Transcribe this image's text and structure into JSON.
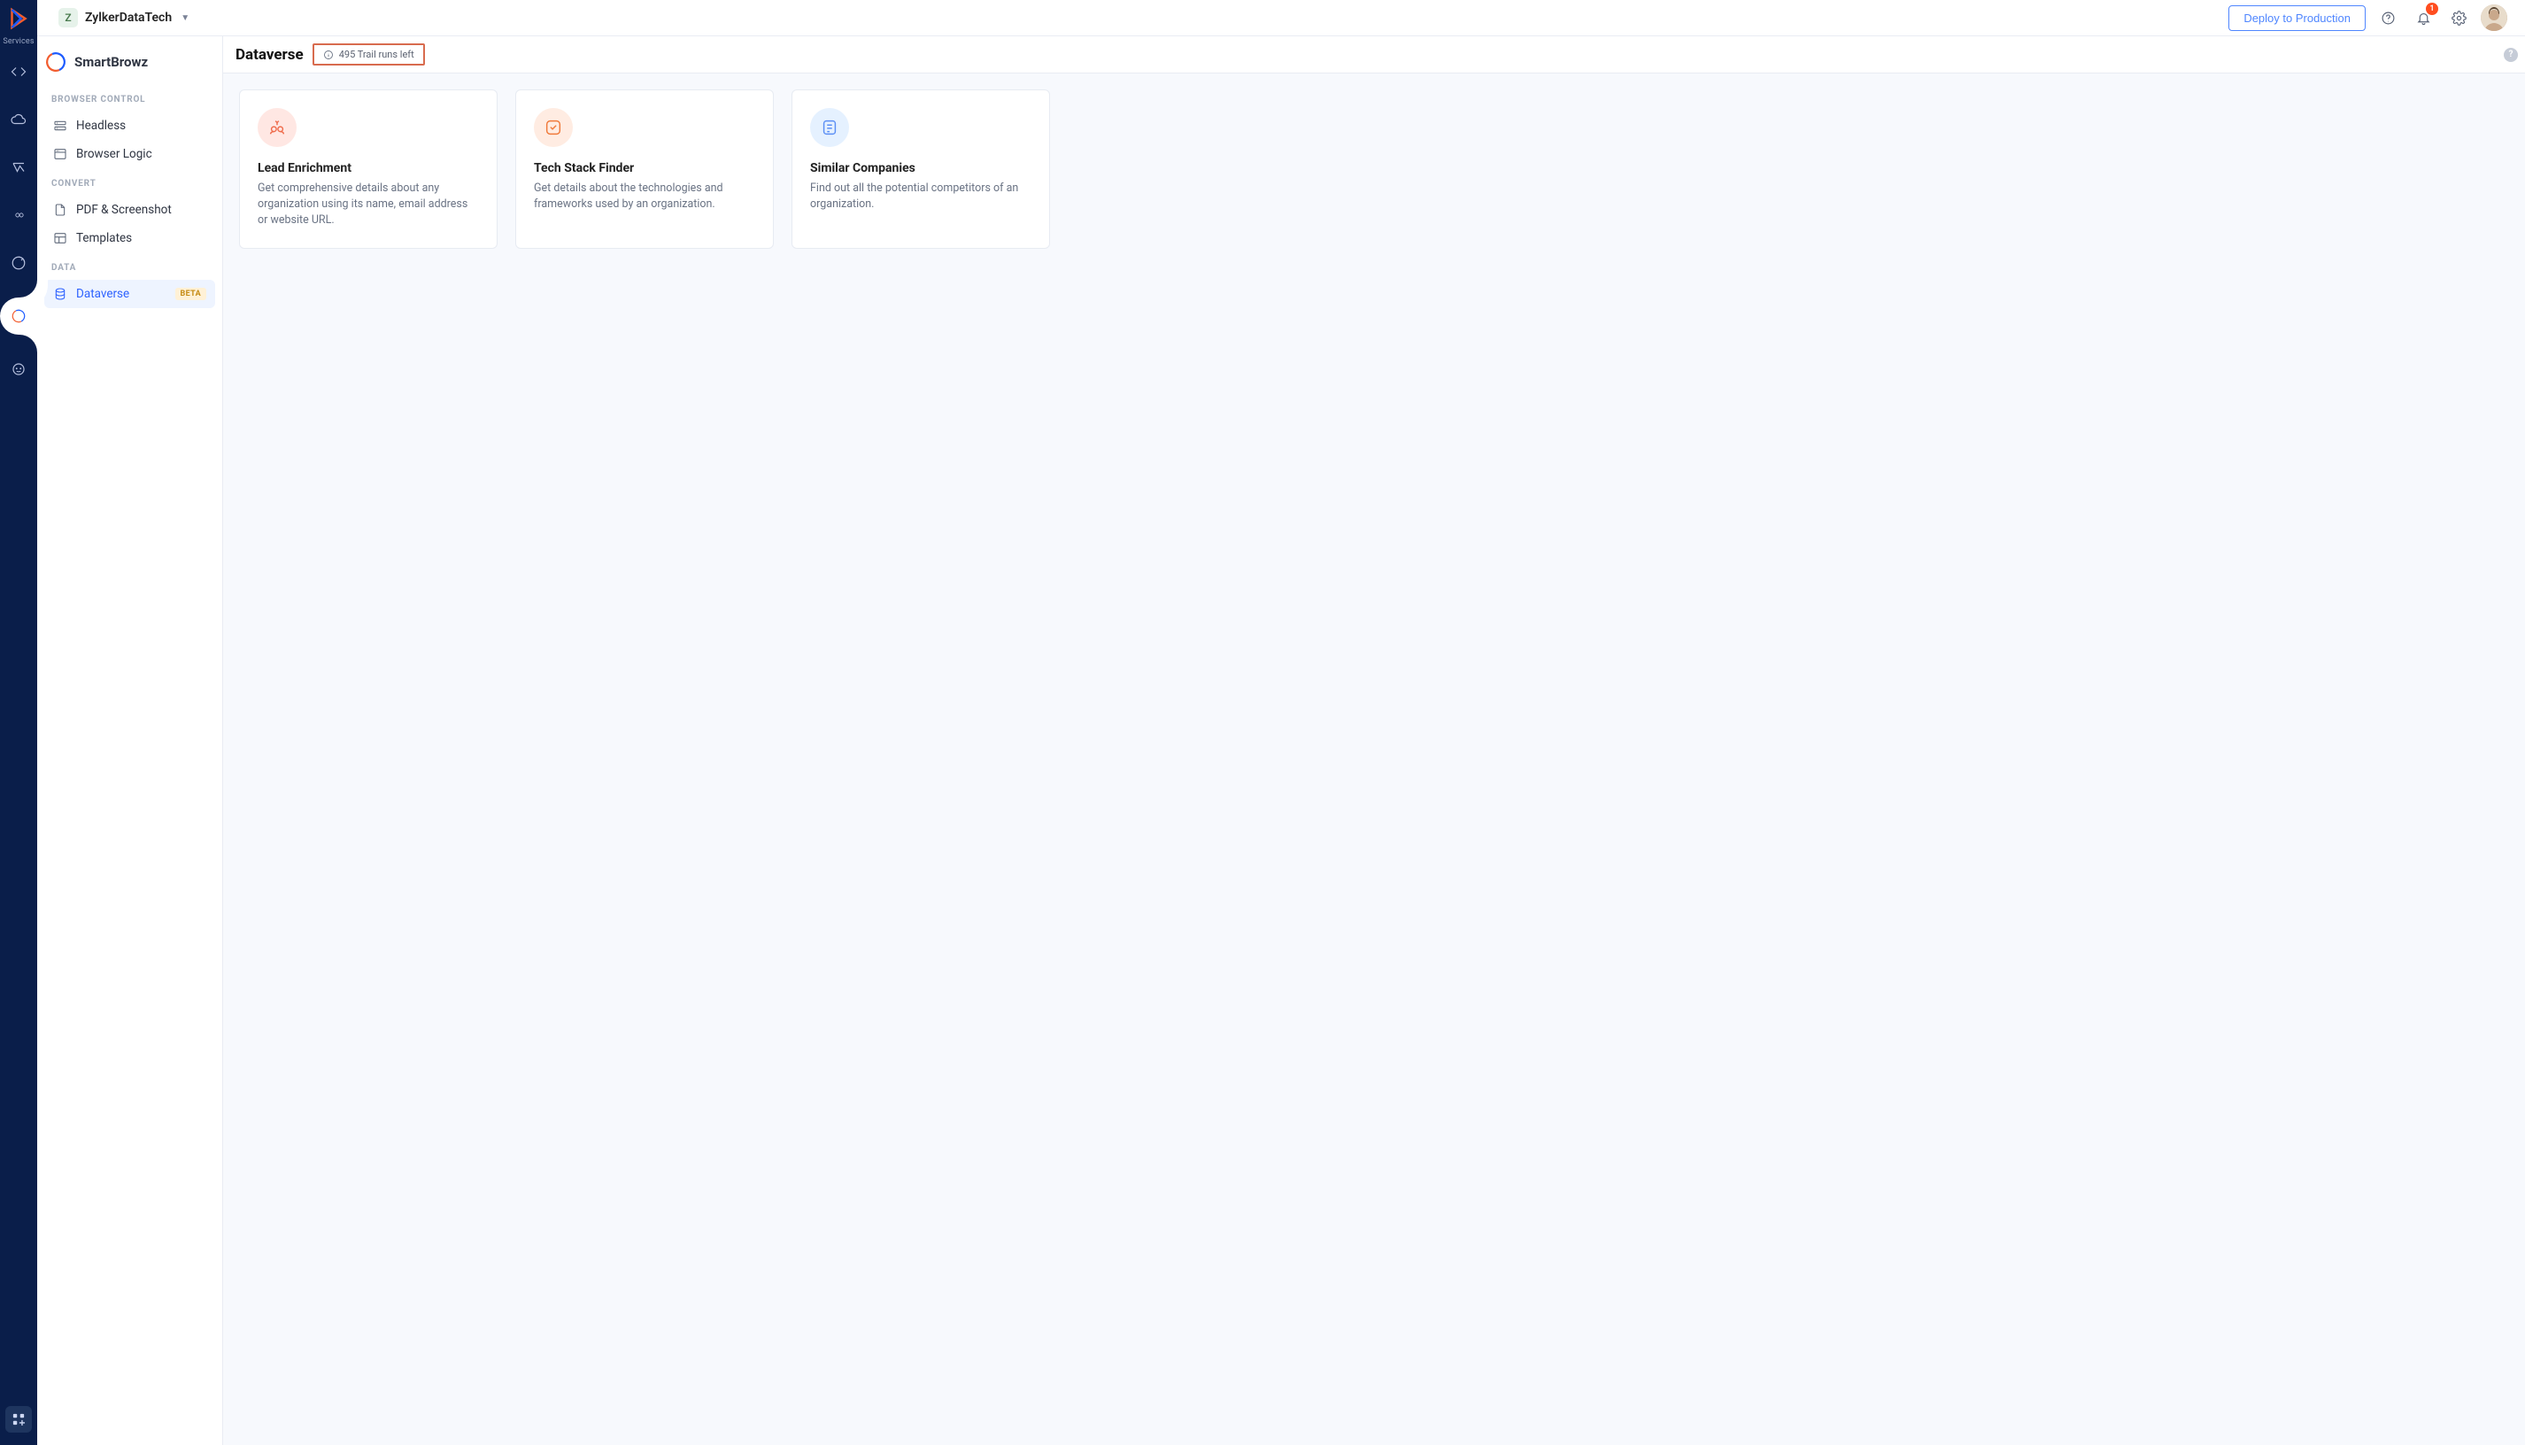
{
  "header": {
    "workspace_initial": "Z",
    "workspace_name": "ZylkerDataTech",
    "deploy_label": "Deploy to Production",
    "notification_count": "1"
  },
  "rail": {
    "services_label": "Services"
  },
  "sidebar": {
    "product_name": "SmartBrowz",
    "sections": {
      "browser_control": {
        "label": "BROWSER CONTROL",
        "items": [
          "Headless",
          "Browser Logic"
        ]
      },
      "convert": {
        "label": "CONVERT",
        "items": [
          "PDF & Screenshot",
          "Templates"
        ]
      },
      "data": {
        "label": "DATA",
        "items": [
          "Dataverse"
        ],
        "beta_label": "BETA"
      }
    }
  },
  "page": {
    "title": "Dataverse",
    "trail_pill": "495 Trail runs left",
    "help_bubble": "?"
  },
  "cards": [
    {
      "title": "Lead Enrichment",
      "desc": "Get comprehensive details about any organization using its name, email address or website URL."
    },
    {
      "title": "Tech Stack Finder",
      "desc": "Get details about the technologies and frameworks used by an organization."
    },
    {
      "title": "Similar Companies",
      "desc": "Find out all the potential competitors of an organization."
    }
  ]
}
